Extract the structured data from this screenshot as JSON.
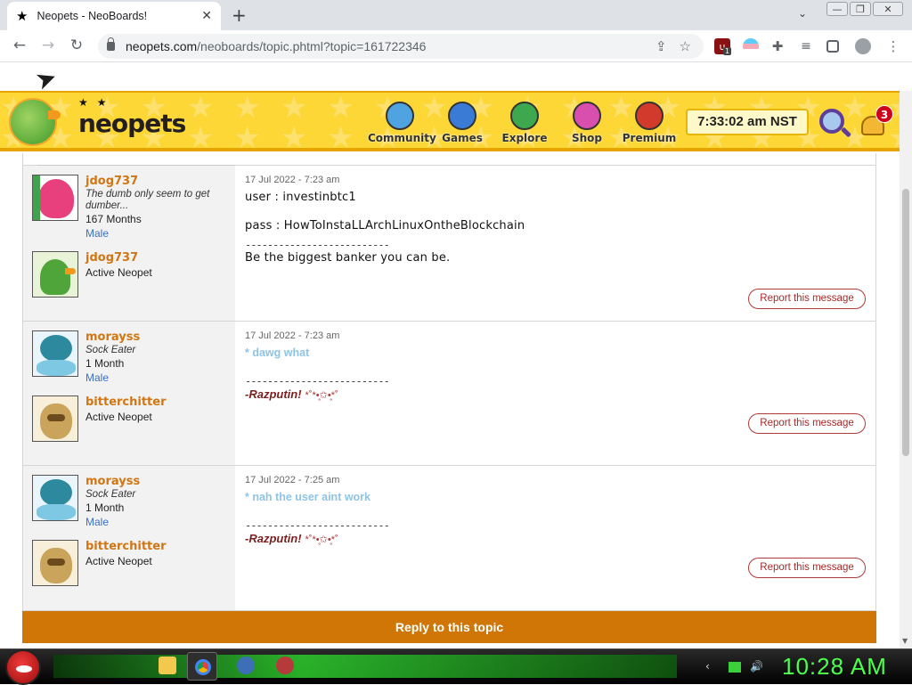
{
  "browser": {
    "tab_title": "Neopets - NeoBoards!",
    "url_host": "neopets.com",
    "url_path": "/neoboards/topic.phtml?topic=161722346",
    "extension_badge": "1"
  },
  "header": {
    "nav": [
      {
        "label": "Community",
        "icon": "community-icon",
        "color": "#4fa3e0"
      },
      {
        "label": "Games",
        "icon": "games-icon",
        "color": "#3a7bd5"
      },
      {
        "label": "Explore",
        "icon": "explore-icon",
        "color": "#3ea84e"
      },
      {
        "label": "Shop",
        "icon": "shop-icon",
        "color": "#d94fae"
      },
      {
        "label": "Premium",
        "icon": "premium-icon",
        "color": "#d23b2b"
      }
    ],
    "clock": "7:33:02 am NST",
    "notification_count": "3"
  },
  "posts": [
    {
      "author": {
        "name": "jdog737",
        "title": "The dumb only seem to get dumber...",
        "months": "167 Months",
        "gender": "Male"
      },
      "pet": {
        "name": "jdog737",
        "status": "Active Neopet"
      },
      "date": "17 Jul 2022 - 7:23 am",
      "lines": [
        "user : investinbtc1",
        "pass : HowToInstaLLArchLinuxOntheBlockchain"
      ],
      "dashes": "--------------------------",
      "signature": "Be the biggest banker you can be.",
      "report_label": "Report this message"
    },
    {
      "author": {
        "name": "morayss",
        "title": "Sock Eater",
        "months": "1 Month",
        "gender": "Male"
      },
      "pet": {
        "name": "bitterchitter",
        "status": "Active Neopet"
      },
      "date": "17 Jul 2022 - 7:23 am",
      "quote": "* dawg what",
      "dashes": "--------------------------",
      "signature": "-Razputin!",
      "sparkle": "*˚*•̥✩•̥*˚",
      "report_label": "Report this message"
    },
    {
      "author": {
        "name": "morayss",
        "title": "Sock Eater",
        "months": "1 Month",
        "gender": "Male"
      },
      "pet": {
        "name": "bitterchitter",
        "status": "Active Neopet"
      },
      "date": "17 Jul 2022 - 7:25 am",
      "quote": "* nah the user aint work",
      "dashes": "--------------------------",
      "signature": "-Razputin!",
      "sparkle": "*˚*•̥✩•̥*˚",
      "report_label": "Report this message"
    }
  ],
  "reply_label": "Reply to this topic",
  "taskbar": {
    "clock": "10:28 AM"
  }
}
